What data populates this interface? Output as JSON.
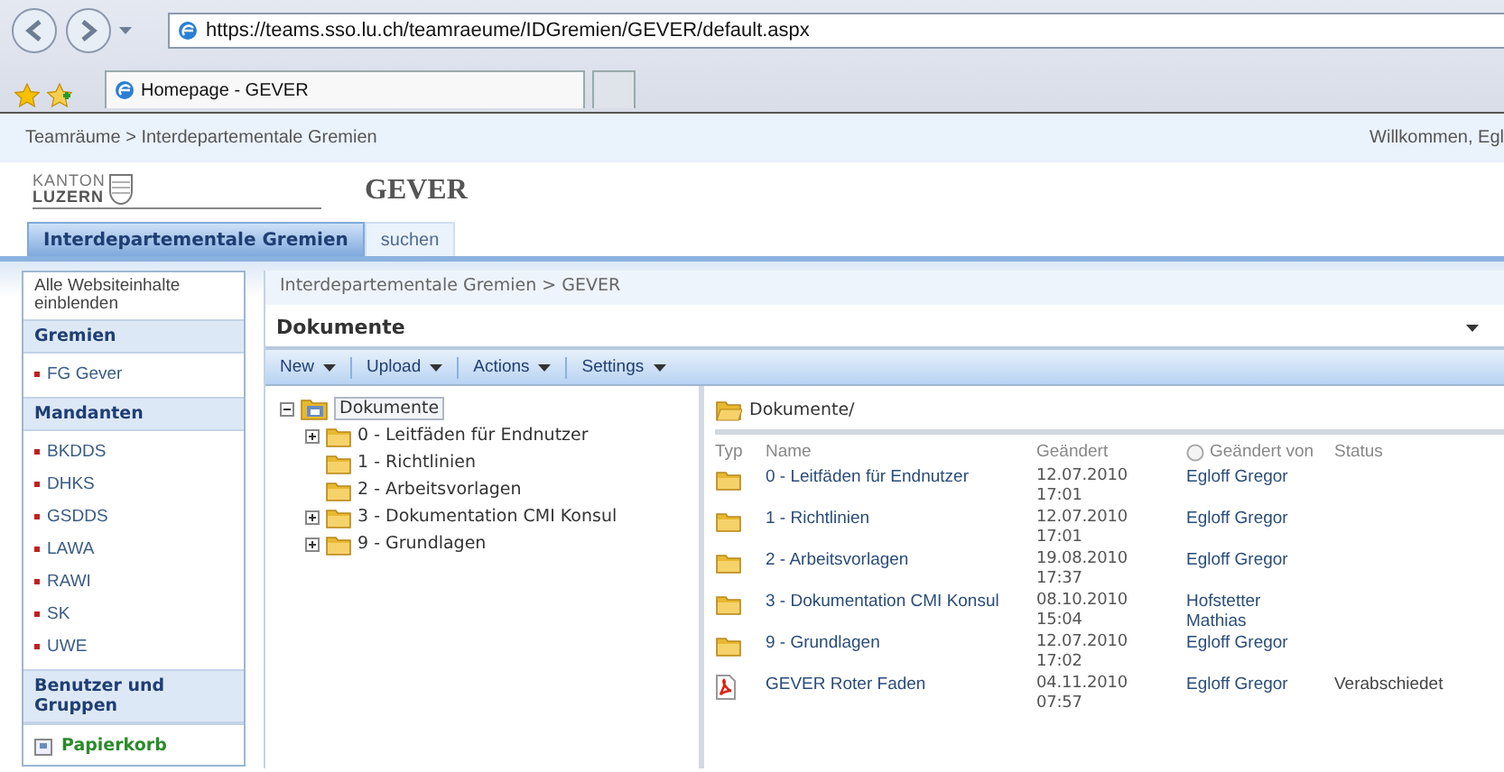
{
  "browser": {
    "address": "https://teams.sso.lu.ch/teamraeume/IDGremien/GEVER/default.aspx",
    "tabs": [
      {
        "label": "Homepage - GEVER",
        "selected": true
      }
    ]
  },
  "top_bar": {
    "breadcrumb": "Teamräume > Interdepartementale Gremien",
    "welcome": "Willkommen, Egl"
  },
  "site": {
    "logo_line_1": "KANTON",
    "logo_line_2": "LUZERN",
    "title": "GEVER"
  },
  "site_tabs": [
    {
      "label": "Interdepartementale Gremien",
      "selected": true
    },
    {
      "label": "suchen",
      "selected": false
    }
  ],
  "quick_launch": {
    "view_all": "Alle Websiteinhalte einblenden",
    "sections": [
      {
        "heading": "Gremien",
        "items": [
          "FG Gever"
        ]
      },
      {
        "heading": "Mandanten",
        "items": [
          "BKDDS",
          "DHKS",
          "GSDDS",
          "LAWA",
          "RAWI",
          "SK",
          "UWE"
        ]
      },
      {
        "heading": "Benutzer und Gruppen"
      }
    ],
    "recycle_bin": "Papierkorb"
  },
  "content": {
    "breadcrumb": "Interdepartementale Gremien > GEVER",
    "title": "Dokumente",
    "toolbar": [
      {
        "label": "New",
        "dropdown": true
      },
      {
        "label": "Upload",
        "dropdown": true
      },
      {
        "label": "Actions",
        "dropdown": true
      },
      {
        "label": "Settings",
        "dropdown": true
      }
    ]
  },
  "tree": {
    "label": "Dokumente",
    "expanded": true,
    "selected": true,
    "children": [
      {
        "label": "0 - Leitfäden für Endnutzer",
        "has_children": true,
        "selected": false
      },
      {
        "label": "1 - Richtlinien",
        "has_children": false,
        "selected": false
      },
      {
        "label": "2 - Arbeitsvorlagen",
        "has_children": false,
        "selected": false
      },
      {
        "label": "3 - Dokumentation CMI Konsul",
        "has_children": true,
        "selected": false
      },
      {
        "label": "9 - Grundlagen",
        "has_children": true,
        "selected": false
      }
    ]
  },
  "list": {
    "path": "Dokumente/",
    "columns": [
      "Typ",
      "Name",
      "Geändert",
      "Geändert von",
      "Status"
    ],
    "rows": [
      {
        "kind": "folder",
        "name": "0 - Leitfäden für Endnutzer",
        "date": "12.07.2010",
        "time": "17:01",
        "modified_by": "Egloff Gregor"
      },
      {
        "kind": "folder",
        "name": "1 - Richtlinien",
        "date": "12.07.2010",
        "time": "17:01",
        "modified_by": "Egloff Gregor"
      },
      {
        "kind": "folder",
        "name": "2 - Arbeitsvorlagen",
        "date": "19.08.2010",
        "time": "17:37",
        "modified_by": "Egloff Gregor"
      },
      {
        "kind": "folder",
        "name": "3 - Dokumentation CMI Konsul",
        "date": "08.10.2010",
        "time": "15:04",
        "modified_by": "Hofstetter Mathias"
      },
      {
        "kind": "folder",
        "name": "9 - Grundlagen",
        "date": "12.07.2010",
        "time": "17:02",
        "modified_by": "Egloff Gregor"
      },
      {
        "kind": "pdf",
        "name": "GEVER Roter Faden",
        "date": "04.11.2010",
        "time": "07:57",
        "modified_by": "Egloff Gregor",
        "status": "Verabschiedet"
      }
    ]
  }
}
